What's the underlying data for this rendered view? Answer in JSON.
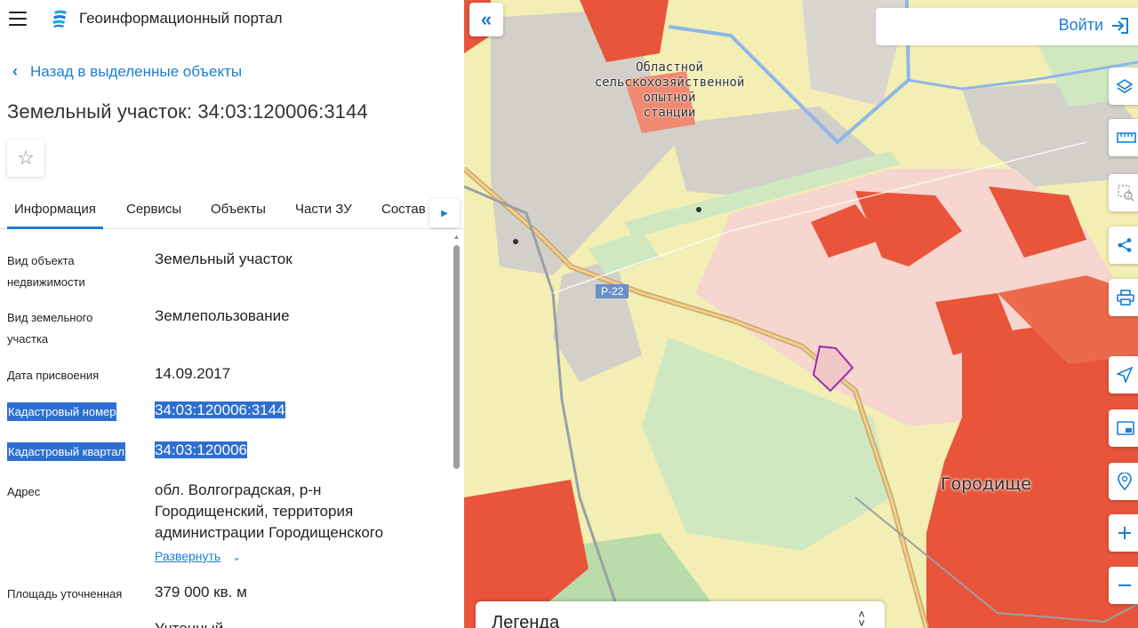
{
  "header": {
    "app_title": "Геоинформационный портал"
  },
  "nav": {
    "back_label": "Назад в выделенные объекты"
  },
  "page": {
    "title": "Земельный участок: 34:03:120006:3144"
  },
  "tabs": [
    {
      "label": "Информация",
      "active": true
    },
    {
      "label": "Сервисы"
    },
    {
      "label": "Объекты"
    },
    {
      "label": "Части ЗУ"
    },
    {
      "label": "Состав"
    }
  ],
  "info": {
    "object_type": {
      "label_1": "Вид объекта",
      "label_2": "недвижимости",
      "value": "Земельный участок"
    },
    "parcel_type": {
      "label_1": "Вид земельного",
      "label_2": "участка",
      "value": "Землепользование"
    },
    "assigned_date": {
      "label": "Дата присвоения",
      "value": "14.09.2017"
    },
    "cadastral_number": {
      "label": "Кадастровый номер",
      "value": "34:03:120006:3144"
    },
    "cadastral_block": {
      "label": "Кадастровый квартал",
      "value": "34:03:120006"
    },
    "address": {
      "label": "Адрес",
      "line_1": "обл. Волгоградская, р-н",
      "line_2": "Городищенский, территория",
      "line_3": "администрации Городищенского",
      "expand_label": "Развернуть"
    },
    "area": {
      "label": "Площадь уточненная",
      "value": "379 000 кв. м"
    },
    "next_value_partial": "Учтенный"
  },
  "map": {
    "label_station_1": "Областной",
    "label_station_2": "сельскохозяйственной",
    "label_station_3": "опытной",
    "label_station_4": "станции",
    "label_town": "Городище",
    "road_shield": "Р-22",
    "login_label": "Войти",
    "legend_title": "Легенда"
  },
  "colors": {
    "accent": "#1a7fd4",
    "highlight": "#2d6fd0",
    "parcel_red": "#e8553a",
    "parcel_outline": "#9b2fb0"
  }
}
